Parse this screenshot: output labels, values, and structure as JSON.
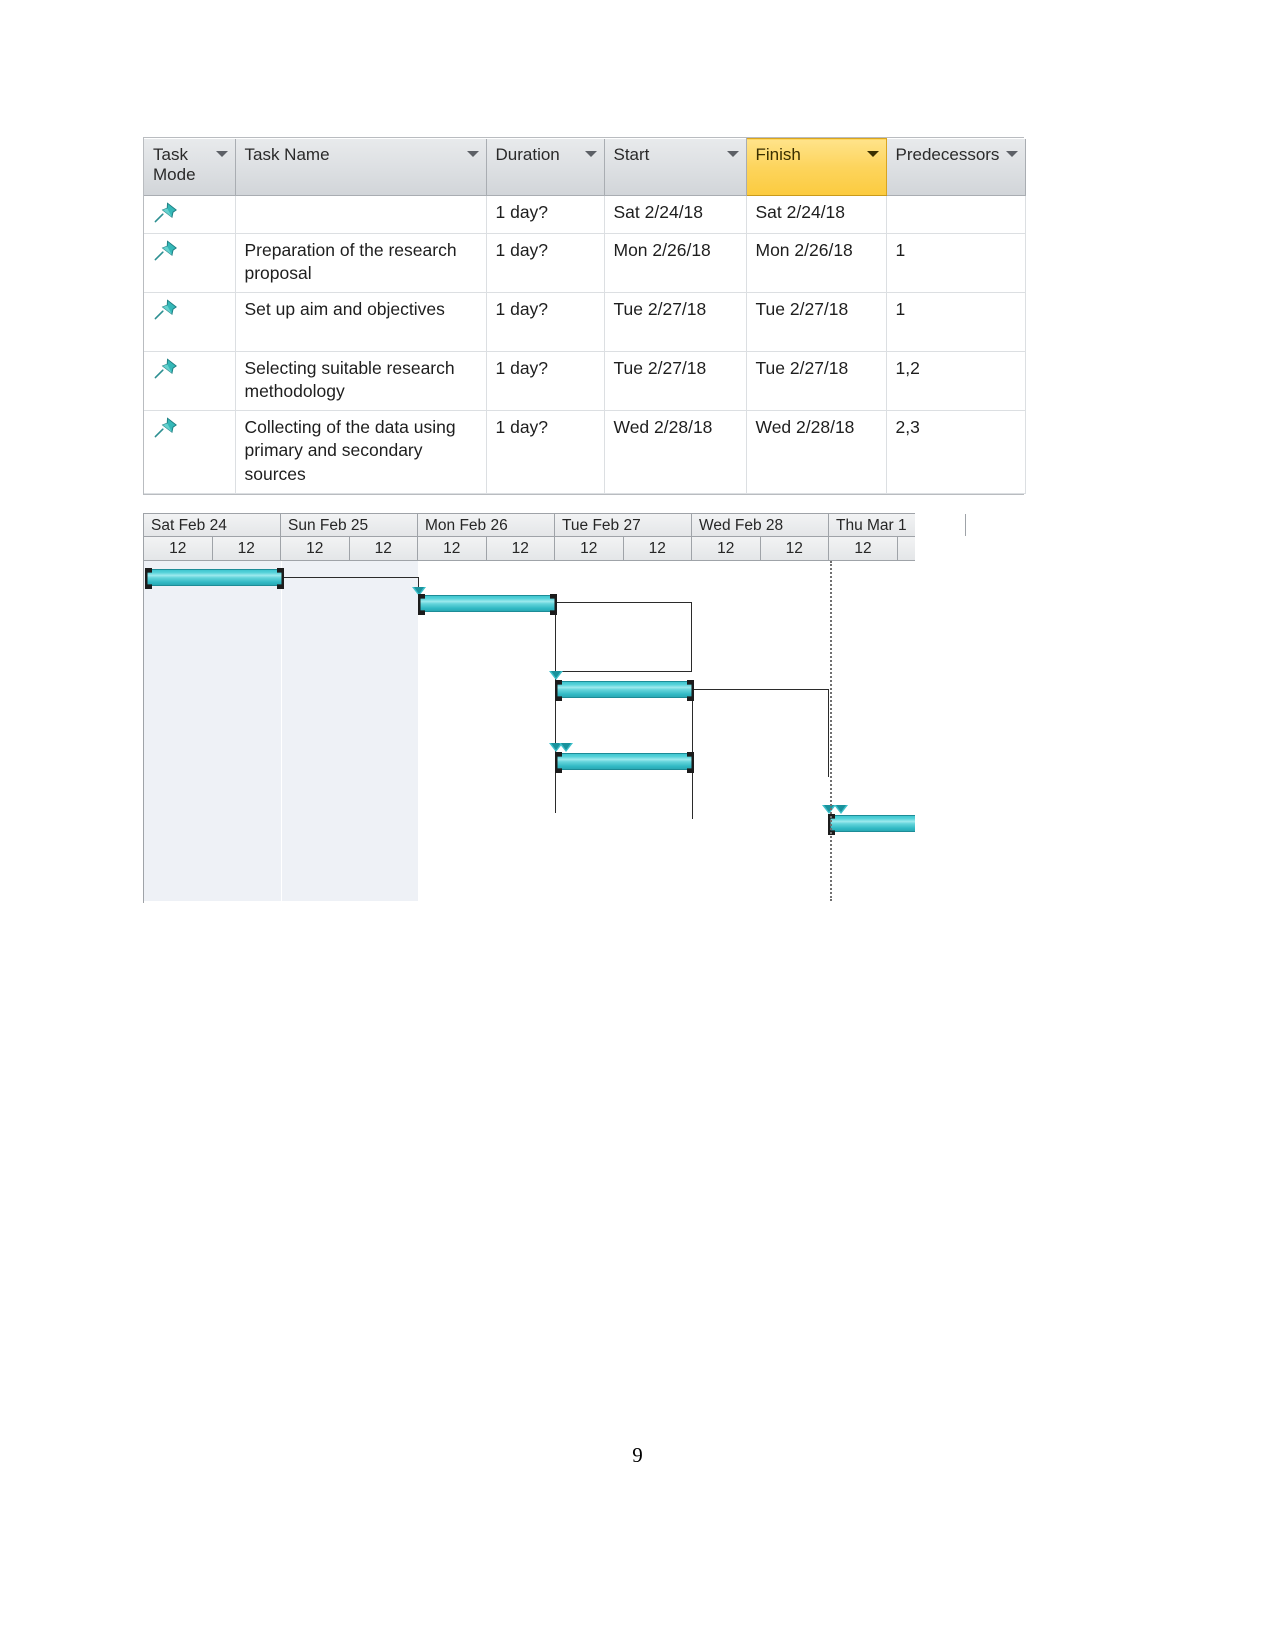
{
  "document": {
    "page_number": "9"
  },
  "task_table": {
    "columns": [
      {
        "key": "task_mode",
        "label": "Task Mode",
        "highlighted": false,
        "has_filter_arrow": true
      },
      {
        "key": "task_name",
        "label": "Task Name",
        "highlighted": false,
        "has_filter_arrow": true
      },
      {
        "key": "duration",
        "label": "Duration",
        "highlighted": false,
        "has_filter_arrow": true
      },
      {
        "key": "start",
        "label": "Start",
        "highlighted": false,
        "has_filter_arrow": true
      },
      {
        "key": "finish",
        "label": "Finish",
        "highlighted": true,
        "has_filter_arrow": true
      },
      {
        "key": "predecessors",
        "label": "Predecessors",
        "highlighted": true,
        "has_filter_arrow": true
      }
    ],
    "highlight_color": "#fdd45c",
    "rows": [
      {
        "mode_icon": "manually-scheduled-pin-icon",
        "task_name": "",
        "duration": "1 day?",
        "start": "Sat 2/24/18",
        "finish": "Sat 2/24/18",
        "predecessors": ""
      },
      {
        "mode_icon": "manually-scheduled-pin-icon",
        "task_name": "Preparation of the research proposal",
        "duration": "1 day?",
        "start": "Mon 2/26/18",
        "finish": "Mon 2/26/18",
        "predecessors": "1"
      },
      {
        "mode_icon": "manually-scheduled-pin-icon",
        "task_name": "Set up aim and objectives",
        "duration": "1 day?",
        "start": "Tue 2/27/18",
        "finish": "Tue 2/27/18",
        "predecessors": "1"
      },
      {
        "mode_icon": "manually-scheduled-pin-icon",
        "task_name": "Selecting suitable research methodology",
        "duration": "1 day?",
        "start": "Tue 2/27/18",
        "finish": "Tue 2/27/18",
        "predecessors": "1,2"
      },
      {
        "mode_icon": "manually-scheduled-pin-icon",
        "task_name": "Collecting of the data using primary and secondary sources",
        "duration": "1 day?",
        "start": "Wed 2/28/18",
        "finish": "Wed 2/28/18",
        "predecessors": "2,3"
      }
    ]
  },
  "gantt": {
    "bar_color": "#3fc5cf",
    "nonworking_color": "#eef1f6",
    "timescale": {
      "tier1": [
        {
          "label": "Sat Feb 24",
          "nonworking": true
        },
        {
          "label": "Sun Feb 25",
          "nonworking": true
        },
        {
          "label": "Mon Feb 26",
          "nonworking": false
        },
        {
          "label": "Tue Feb 27",
          "nonworking": false
        },
        {
          "label": "Wed Feb 28",
          "nonworking": false
        },
        {
          "label": "Thu Mar 1",
          "nonworking": false
        }
      ],
      "tier2_labels": [
        "12",
        "12",
        "12",
        "12",
        "12",
        "12",
        "12",
        "12",
        "12",
        "12",
        "12"
      ]
    },
    "bars": [
      {
        "task": "",
        "start_day": "Sat Feb 24",
        "finish_day": "Sat Feb 24"
      },
      {
        "task": "Preparation of the research proposal",
        "start_day": "Mon Feb 26",
        "finish_day": "Mon Feb 26"
      },
      {
        "task": "Set up aim and objectives",
        "start_day": "Tue Feb 27",
        "finish_day": "Tue Feb 27"
      },
      {
        "task": "Selecting suitable research methodology",
        "start_day": "Tue Feb 27",
        "finish_day": "Tue Feb 27"
      },
      {
        "task": "Collecting of the data using primary and secondary sources",
        "start_day": "Wed Feb 28",
        "finish_day": "Wed Feb 28"
      }
    ],
    "links": [
      {
        "from": 1,
        "to": 2
      },
      {
        "from": 2,
        "to": 3
      },
      {
        "from": 1,
        "to": 4
      },
      {
        "from": 2,
        "to": 4
      },
      {
        "from": 3,
        "to": 5
      },
      {
        "from": 4,
        "to": 5
      }
    ],
    "status_line": {
      "visible": true,
      "label": ""
    }
  }
}
